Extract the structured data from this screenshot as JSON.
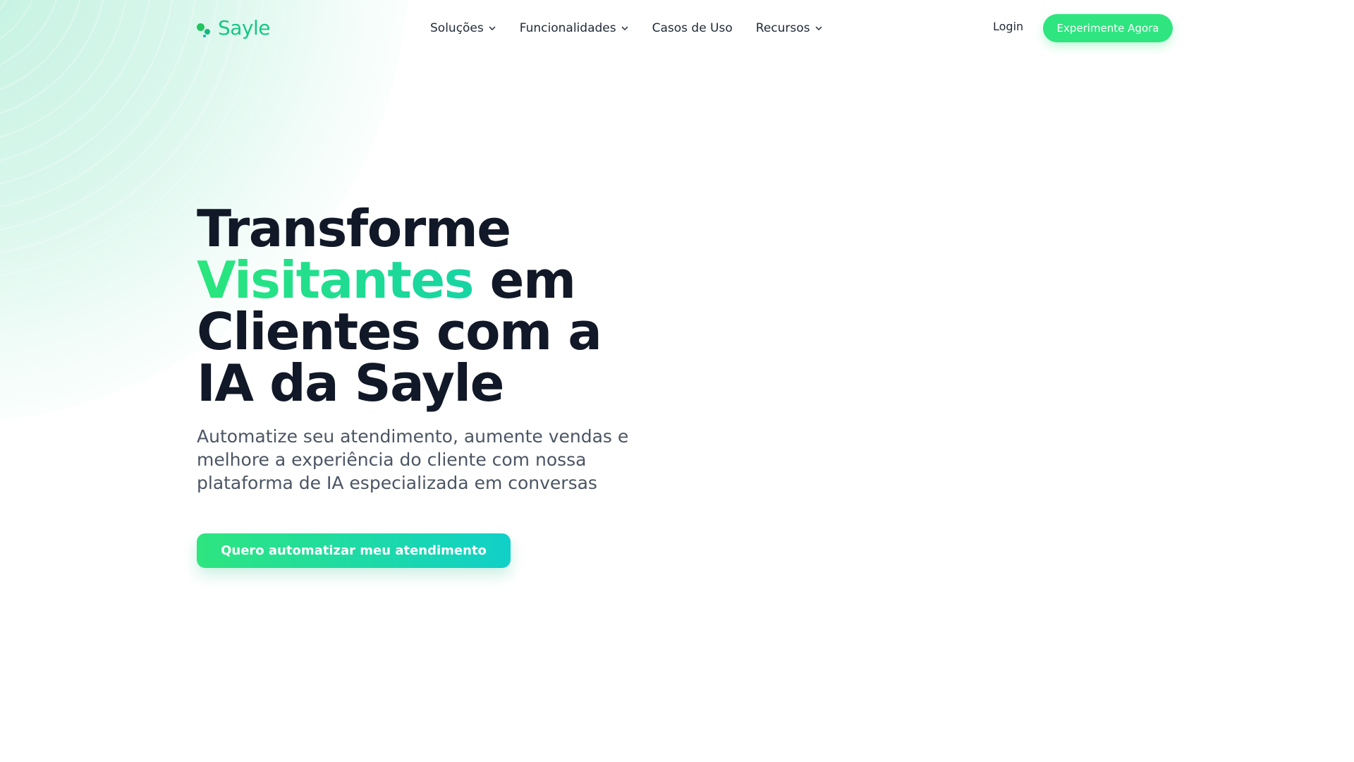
{
  "brand": {
    "name": "Sayle",
    "colors": {
      "accent": "#2ee57f",
      "accent_teal": "#10d0c8",
      "heading": "#111827",
      "body_text": "#4b5563"
    }
  },
  "nav": {
    "items": [
      {
        "label": "Soluções",
        "icon": "chevron-down-icon"
      },
      {
        "label": "Funcionalidades",
        "icon": "chevron-down-icon"
      },
      {
        "label": "Casos de Uso",
        "icon": ""
      },
      {
        "label": "Recursos",
        "icon": "chevron-down-icon"
      }
    ],
    "login_label": "Login",
    "cta_label": "Experimente Agora"
  },
  "hero": {
    "title_line1": "Transforme",
    "title_highlight": "Visitantes",
    "title_after_highlight": " em",
    "title_line3": "Clientes com a",
    "title_line4": "IA da Sayle",
    "subtitle": "Automatize seu atendimento, aumente vendas e melhore a experiência do cliente com nossa plataforma de IA especializada em conversas",
    "cta_label": "Quero automatizar meu atendimento"
  }
}
